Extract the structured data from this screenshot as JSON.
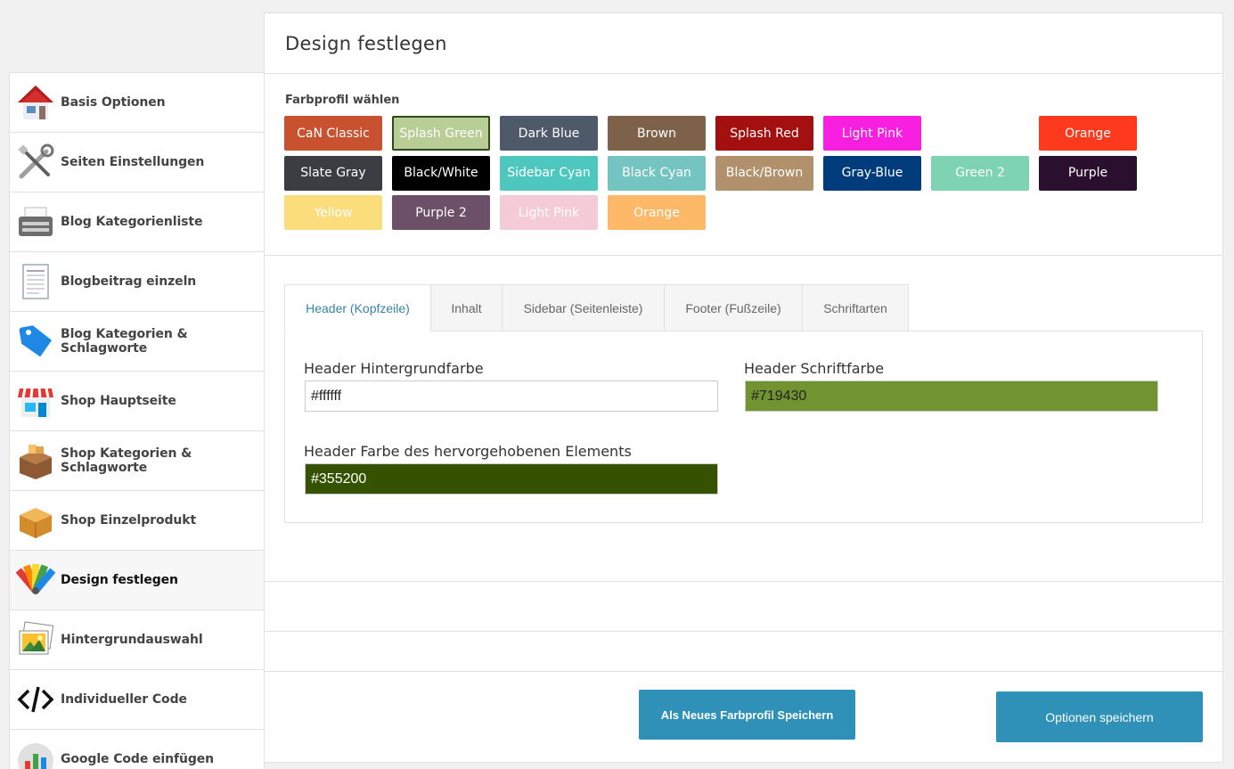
{
  "sidebar": {
    "items": [
      {
        "label": "Basis Optionen",
        "icon": "house-icon"
      },
      {
        "label": "Seiten Einstellungen",
        "icon": "tools-icon"
      },
      {
        "label": "Blog Kategorienliste",
        "icon": "typewriter-icon"
      },
      {
        "label": "Blogbeitrag einzeln",
        "icon": "document-icon"
      },
      {
        "label": "Blog Kategorien & Schlagworte",
        "icon": "tag-icon"
      },
      {
        "label": "Shop Hauptseite",
        "icon": "storefront-icon"
      },
      {
        "label": "Shop Kategorien & Schlagworte",
        "icon": "open-box-icon"
      },
      {
        "label": "Shop Einzelprodukt",
        "icon": "box-icon"
      },
      {
        "label": "Design festlegen",
        "icon": "color-palette-icon"
      },
      {
        "label": "Hintergrundauswahl",
        "icon": "images-icon"
      },
      {
        "label": "Individueller Code",
        "icon": "code-icon"
      },
      {
        "label": "Google Code einfügen",
        "icon": "chart-icon"
      }
    ]
  },
  "page": {
    "title": "Design festlegen"
  },
  "profiles": {
    "label": "Farbprofil wählen",
    "items": [
      {
        "label": "CaN Classic",
        "bg": "#c8512f",
        "fg": "#ffffff"
      },
      {
        "label": "Splash Green",
        "bg": "#b9cd97",
        "fg": "#ffffff"
      },
      {
        "label": "Dark Blue",
        "bg": "#4e5a6a",
        "fg": "#ffffff"
      },
      {
        "label": "Brown",
        "bg": "#7d6249",
        "fg": "#ffffff"
      },
      {
        "label": "Splash Red",
        "bg": "#a3100f",
        "fg": "#ffffff"
      },
      {
        "label": "Light Pink",
        "bg": "#f81fe0",
        "fg": "#ffffff"
      },
      {
        "label": "Orange",
        "bg": "#fe3a1e",
        "fg": "#ffffff"
      },
      {
        "label": "Slate Gray",
        "bg": "#3b3d42",
        "fg": "#ffffff"
      },
      {
        "label": "Black/White",
        "bg": "#000000",
        "fg": "#ffffff"
      },
      {
        "label": "Sidebar Cyan",
        "bg": "#4ec7bf",
        "fg": "#ffffff"
      },
      {
        "label": "Black Cyan",
        "bg": "#74c5c1",
        "fg": "#ffffff"
      },
      {
        "label": "Black/Brown",
        "bg": "#b0916c",
        "fg": "#ffffff"
      },
      {
        "label": "Gray-Blue",
        "bg": "#003c7b",
        "fg": "#ffffff"
      },
      {
        "label": "Green 2",
        "bg": "#7ed3b2",
        "fg": "#ffffff"
      },
      {
        "label": "Purple",
        "bg": "#2b0f2e",
        "fg": "#ffffff"
      },
      {
        "label": "Yellow",
        "bg": "#fcdd7b",
        "fg": "#ffffff"
      },
      {
        "label": "Purple 2",
        "bg": "#6b5068",
        "fg": "#ffffff"
      },
      {
        "label": "Light Pink",
        "bg": "#f5cbd8",
        "fg": "#ffffff"
      },
      {
        "label": "Orange",
        "bg": "#feb968",
        "fg": "#ffffff"
      }
    ]
  },
  "tabs": [
    {
      "label": "Header (Kopfzeile)"
    },
    {
      "label": "Inhalt"
    },
    {
      "label": "Sidebar (Seitenleiste)"
    },
    {
      "label": "Footer (Fußzeile)"
    },
    {
      "label": "Schriftarten"
    }
  ],
  "header_fields": {
    "bg_label": "Header Hintergrundfarbe",
    "bg_value": "#ffffff",
    "font_label": "Header Schriftfarbe",
    "font_value": "#719430",
    "highlight_label": "Header Farbe des hervorgehobenen Elements",
    "highlight_value": "#355200"
  },
  "buttons": {
    "save_profile": "Als Neues Farbprofil Speichern",
    "save_options": "Optionen speichern"
  }
}
